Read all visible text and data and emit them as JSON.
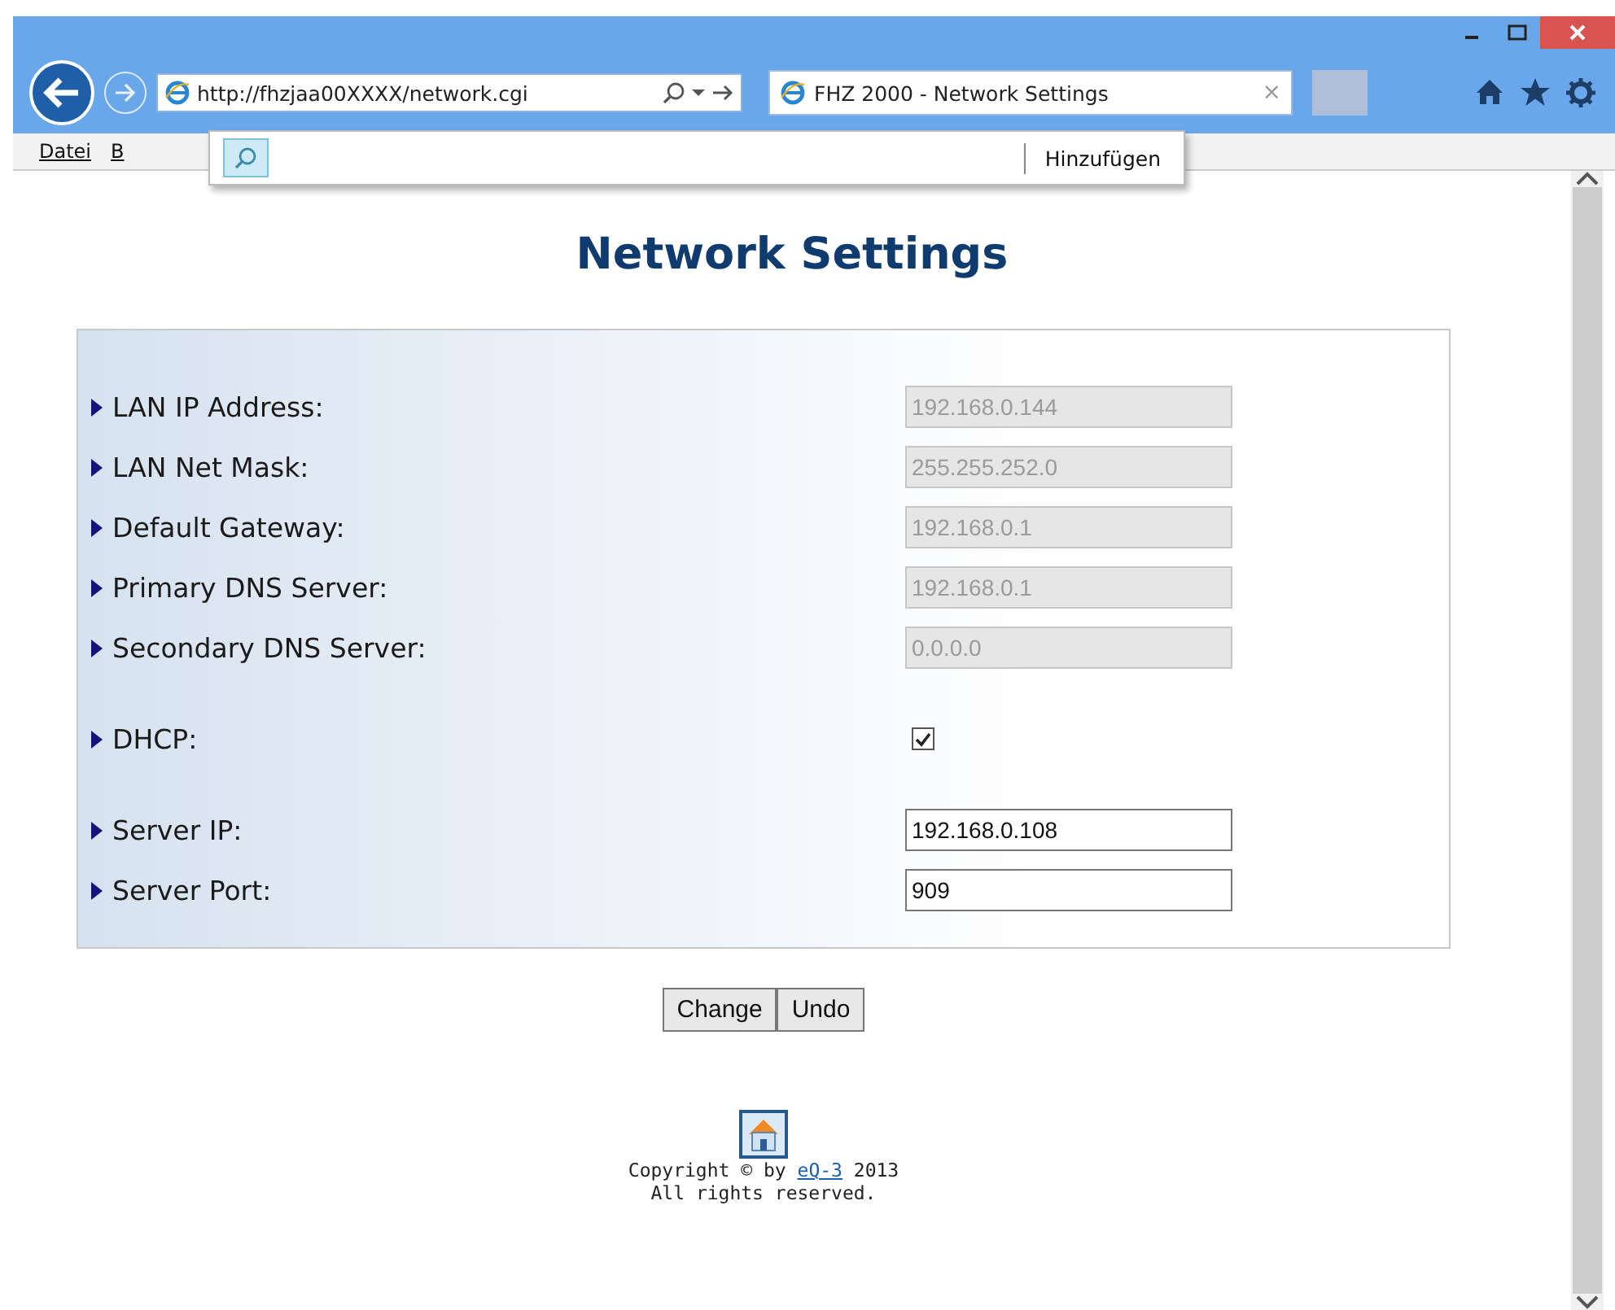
{
  "browser": {
    "address_url": "http://fhzjaa00XXXX/network.cgi",
    "tab": {
      "title": "FHZ 2000 - Network Settings",
      "close": "×",
      "selected": true
    }
  },
  "menu_bar": [
    "Datei",
    "B"
  ],
  "address_popup": {
    "action": "Hinzufügen"
  },
  "page": {
    "heading": "Network Settings",
    "groups": [
      [
        {
          "label": "LAN IP Address:",
          "kind": "text",
          "value": "192.168.0.144",
          "disabled": true
        },
        {
          "label": "LAN Net Mask:",
          "kind": "text",
          "value": "255.255.252.0",
          "disabled": true
        },
        {
          "label": "Default Gateway:",
          "kind": "text",
          "value": "192.168.0.1",
          "disabled": true
        },
        {
          "label": "Primary DNS Server:",
          "kind": "text",
          "value": "192.168.0.1",
          "disabled": true
        },
        {
          "label": "Secondary DNS Server:",
          "kind": "text",
          "value": "0.0.0.0",
          "disabled": true
        }
      ],
      [
        {
          "label": "DHCP:",
          "kind": "checkbox",
          "checked": true
        }
      ],
      [
        {
          "label": "Server IP:",
          "kind": "text",
          "value": "192.168.0.108",
          "disabled": false
        },
        {
          "label": "Server Port:",
          "kind": "text",
          "value": "909",
          "disabled": false
        }
      ]
    ],
    "buttons": [
      "Change",
      "Undo"
    ],
    "footer": {
      "copyright_before": "Copyright © by",
      "copyright_link": "eQ-3",
      "copyright_after": "2013",
      "rights": "All rights reserved."
    }
  }
}
